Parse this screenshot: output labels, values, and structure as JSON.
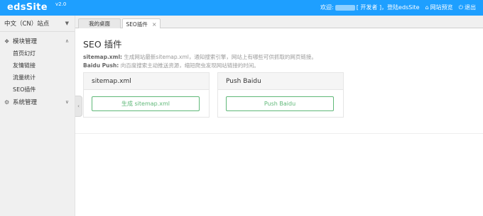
{
  "header": {
    "logo": "edsSite",
    "version": "v2.0",
    "welcome_prefix": "欢迎:",
    "welcome_suffix": "[ 开发者 ]，登陆edsSite",
    "preview_label": "网站预览",
    "logout_label": "退出"
  },
  "sidebar": {
    "site_select": "中文（CN）站点",
    "groups": [
      {
        "label": "模块管理",
        "items": [
          "首页幻灯",
          "友情链接",
          "流量统计",
          "SEO插件"
        ]
      },
      {
        "label": "系统管理"
      }
    ]
  },
  "tabs": [
    {
      "label": "我的桌面"
    },
    {
      "label": "SEO插件"
    }
  ],
  "main": {
    "title": "SEO 插件",
    "desc1_key": "sitemap.xml:",
    "desc1_text": " 生成网站最新sitemap.xml，通知搜索引擎，网站上有哪些可供抓取的网页链接。",
    "desc2_key": "Baidu Push:",
    "desc2_text": " 向百度搜索主动推送资源，缩短爬虫发现网站链接的时间。",
    "cards": [
      {
        "title": "sitemap.xml",
        "button": "生成 sitemap.xml"
      },
      {
        "title": "Push Baidu",
        "button": "Push Baidu"
      }
    ]
  },
  "colors": {
    "header": "#1e9fff",
    "button": "#5fb878"
  },
  "icons": [
    "home-icon",
    "power-icon",
    "chevron-down-icon",
    "chevron-left-icon",
    "close-icon",
    "gear-icon"
  ]
}
